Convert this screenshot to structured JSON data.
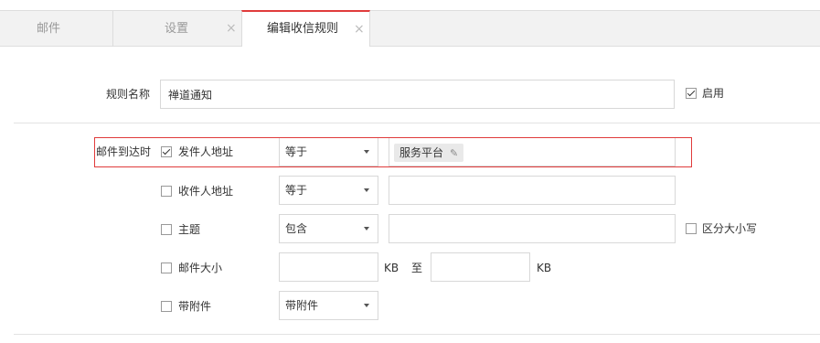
{
  "tabs": {
    "mail": "邮件",
    "settings": "设置",
    "edit_rule": "编辑收信规则",
    "close": "×"
  },
  "rule_name": {
    "label": "规则名称",
    "value": "禅道通知",
    "enable_label": "启用",
    "enabled": true
  },
  "condition_group_label": "邮件到达时",
  "conditions": {
    "sender": {
      "label": "发件人地址",
      "checked": true,
      "operator": "等于",
      "tag": "服务平台",
      "tag_edit_icon": "pencil-icon"
    },
    "recipient": {
      "label": "收件人地址",
      "checked": false,
      "operator": "等于",
      "value": ""
    },
    "subject": {
      "label": "主题",
      "checked": false,
      "operator": "包含",
      "value": "",
      "case_label": "区分大小写"
    },
    "size": {
      "label": "邮件大小",
      "checked": false,
      "min": "",
      "unit_min": "KB",
      "to": "至",
      "max": "",
      "unit_max": "KB"
    },
    "attachment": {
      "label": "带附件",
      "checked": false,
      "operator": "带附件"
    }
  },
  "colors": {
    "accent": "#e03b3b",
    "tab_bg": "#f2f2f2",
    "border": "#d8d8d8"
  }
}
